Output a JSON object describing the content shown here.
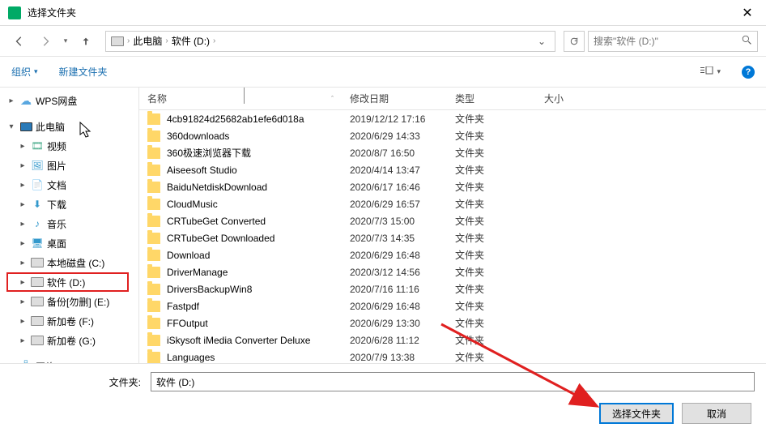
{
  "window": {
    "title": "选择文件夹"
  },
  "breadcrumb": {
    "root": "此电脑",
    "current": "软件 (D:)"
  },
  "search": {
    "placeholder": "搜索\"软件 (D:)\""
  },
  "toolbar": {
    "organize": "组织",
    "newfolder": "新建文件夹"
  },
  "columns": {
    "name": "名称",
    "date": "修改日期",
    "type": "类型",
    "size": "大小"
  },
  "sidebar": [
    {
      "label": "WPS网盘",
      "icon": "cloud",
      "arrow": "▸",
      "indent": 1
    },
    {
      "label": "此电脑",
      "icon": "monitor",
      "arrow": "▾",
      "indent": 1
    },
    {
      "label": "视频",
      "icon": "video",
      "arrow": "▸",
      "indent": 2
    },
    {
      "label": "图片",
      "icon": "pic",
      "arrow": "▸",
      "indent": 2
    },
    {
      "label": "文档",
      "icon": "doc",
      "arrow": "▸",
      "indent": 2
    },
    {
      "label": "下载",
      "icon": "down",
      "arrow": "▸",
      "indent": 2
    },
    {
      "label": "音乐",
      "icon": "music",
      "arrow": "▸",
      "indent": 2
    },
    {
      "label": "桌面",
      "icon": "desktop",
      "arrow": "▸",
      "indent": 2
    },
    {
      "label": "本地磁盘 (C:)",
      "icon": "drive",
      "arrow": "▸",
      "indent": 2
    },
    {
      "label": "软件 (D:)",
      "icon": "drive",
      "arrow": "▸",
      "indent": 2,
      "highlighted": true
    },
    {
      "label": "备份[勿删] (E:)",
      "icon": "drive",
      "arrow": "▸",
      "indent": 2
    },
    {
      "label": "新加卷 (F:)",
      "icon": "drive",
      "arrow": "▸",
      "indent": 2
    },
    {
      "label": "新加卷 (G:)",
      "icon": "drive",
      "arrow": "▸",
      "indent": 2
    },
    {
      "label": "网络",
      "icon": "network",
      "arrow": "▸",
      "indent": 1
    }
  ],
  "files": [
    {
      "name": "4cb91824d25682ab1efe6d018a",
      "date": "2019/12/12 17:16",
      "type": "文件夹"
    },
    {
      "name": "360downloads",
      "date": "2020/6/29 14:33",
      "type": "文件夹"
    },
    {
      "name": "360极速浏览器下载",
      "date": "2020/8/7 16:50",
      "type": "文件夹"
    },
    {
      "name": "Aiseesoft Studio",
      "date": "2020/4/14 13:47",
      "type": "文件夹"
    },
    {
      "name": "BaiduNetdiskDownload",
      "date": "2020/6/17 16:46",
      "type": "文件夹"
    },
    {
      "name": "CloudMusic",
      "date": "2020/6/29 16:57",
      "type": "文件夹"
    },
    {
      "name": "CRTubeGet Converted",
      "date": "2020/7/3 15:00",
      "type": "文件夹"
    },
    {
      "name": "CRTubeGet Downloaded",
      "date": "2020/7/3 14:35",
      "type": "文件夹"
    },
    {
      "name": "Download",
      "date": "2020/6/29 16:48",
      "type": "文件夹"
    },
    {
      "name": "DriverManage",
      "date": "2020/3/12 14:56",
      "type": "文件夹"
    },
    {
      "name": "DriversBackupWin8",
      "date": "2020/7/16 11:16",
      "type": "文件夹"
    },
    {
      "name": "Fastpdf",
      "date": "2020/6/29 16:48",
      "type": "文件夹"
    },
    {
      "name": "FFOutput",
      "date": "2020/6/29 13:30",
      "type": "文件夹"
    },
    {
      "name": "iSkysoft iMedia Converter Deluxe",
      "date": "2020/6/28 11:12",
      "type": "文件夹"
    },
    {
      "name": "Languages",
      "date": "2020/7/9 13:38",
      "type": "文件夹"
    }
  ],
  "folderfield": {
    "label": "文件夹:",
    "value": "软件 (D:)"
  },
  "buttons": {
    "select": "选择文件夹",
    "cancel": "取消"
  }
}
